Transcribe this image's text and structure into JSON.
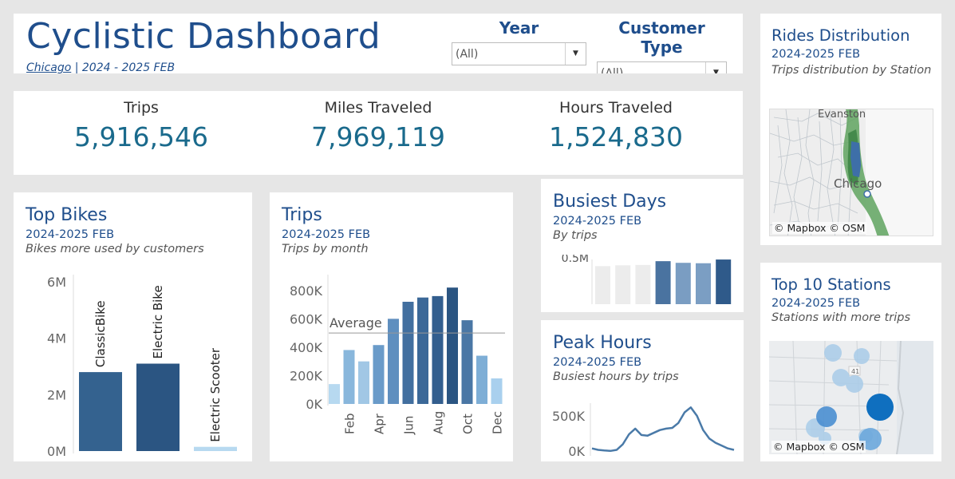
{
  "header": {
    "title": "Cyclistic Dashboard",
    "location": "Chicago",
    "period": " | 2024 - 2025 FEB",
    "filters": [
      {
        "label": "Year",
        "value": "(All)"
      },
      {
        "label": "Customer Type",
        "value": "(All)"
      }
    ]
  },
  "kpis": [
    {
      "label": "Trips",
      "value": "5,916,546"
    },
    {
      "label": "Miles Traveled",
      "value": "7,969,119"
    },
    {
      "label": "Hours Traveled",
      "value": "1,524,830"
    }
  ],
  "rides": {
    "title": "Rides Distribution",
    "subtitle": "2024-2025 FEB",
    "description": "Trips distribution by Station",
    "map_label_1": "Evanston",
    "map_label_2": "Chicago",
    "credit": "© Mapbox © OSM"
  },
  "stations": {
    "title": "Top 10 Stations",
    "subtitle": "2024-2025 FEB",
    "description": "Stations with more trips",
    "road_label": "41",
    "credit": "© Mapbox © OSM"
  },
  "top_bikes": {
    "title": "Top Bikes",
    "subtitle": "2024-2025 FEB",
    "description": "Bikes more used by customers"
  },
  "trips_chart": {
    "title": "Trips",
    "subtitle": "2024-2025 FEB",
    "description": "Trips by month"
  },
  "busiest": {
    "title": "Busiest Days",
    "subtitle": "2024-2025 FEB",
    "description": "By trips"
  },
  "peak": {
    "title": "Peak Hours",
    "subtitle": "2024-2025 FEB",
    "description": "Busiest hours by trips"
  },
  "chart_data": [
    {
      "id": "top_bikes",
      "type": "bar",
      "categories": [
        "ClassicBike",
        "Electric Bike",
        "Electric Scooter"
      ],
      "values": [
        2800000,
        3100000,
        150000
      ],
      "colors": [
        "#34628f",
        "#2b5582",
        "#b7d9f0"
      ],
      "ylim": [
        0,
        6200000
      ],
      "yticks": [
        0,
        2000000,
        4000000,
        6000000
      ],
      "ytick_labels": [
        "0M",
        "2M",
        "4M",
        "6M"
      ]
    },
    {
      "id": "trips_by_month",
      "type": "bar",
      "categories": [
        "Jan",
        "Feb",
        "Mar",
        "Apr",
        "May",
        "Jun",
        "Jul",
        "Aug",
        "Sep",
        "Oct",
        "Nov",
        "Dec"
      ],
      "x_tick_labels": [
        "",
        "Feb",
        "",
        "Apr",
        "",
        "Jun",
        "",
        "Aug",
        "",
        "Oct",
        "",
        "Dec"
      ],
      "values": [
        140000,
        380000,
        300000,
        415000,
        600000,
        720000,
        750000,
        760000,
        820000,
        590000,
        340000,
        180000
      ],
      "colors": [
        "#b7d9f0",
        "#89b7dc",
        "#a1c7e5",
        "#6a9bc9",
        "#5f8fbf",
        "#426f9f",
        "#3b6898",
        "#335e8e",
        "#2b5582",
        "#4a77a5",
        "#7eaed6",
        "#a9d0ee"
      ],
      "average": 500000,
      "average_label": "Average",
      "ylim": [
        0,
        900000
      ],
      "yticks": [
        0,
        200000,
        400000,
        600000,
        800000
      ],
      "ytick_labels": [
        "0K",
        "200K",
        "400K",
        "600K",
        "800K"
      ]
    },
    {
      "id": "busiest_days",
      "type": "bar",
      "categories": [
        "1",
        "2",
        "3",
        "4",
        "5",
        "6",
        "7"
      ],
      "values": [
        460000,
        470000,
        475000,
        520000,
        500000,
        495000,
        540000
      ],
      "colors": [
        "#ececec",
        "#ececec",
        "#ececec",
        "#4a73a0",
        "#7a9dc2",
        "#7b9ec3",
        "#2f5a8a"
      ],
      "ylim": [
        0,
        560000
      ],
      "yticks": [
        500000
      ],
      "ytick_labels": [
        "0.5M"
      ]
    },
    {
      "id": "peak_hours",
      "type": "line",
      "x": [
        0,
        1,
        2,
        3,
        4,
        5,
        6,
        7,
        8,
        9,
        10,
        11,
        12,
        13,
        14,
        15,
        16,
        17,
        18,
        19,
        20,
        21,
        22,
        23
      ],
      "values": [
        40000,
        20000,
        10000,
        5000,
        20000,
        100000,
        240000,
        320000,
        230000,
        220000,
        260000,
        300000,
        320000,
        330000,
        400000,
        550000,
        620000,
        500000,
        300000,
        180000,
        120000,
        80000,
        40000,
        20000
      ],
      "color": "#4a7aa8",
      "ylim": [
        -20000,
        680000
      ],
      "yticks": [
        0,
        500000
      ],
      "ytick_labels": [
        "0K",
        "500K"
      ]
    }
  ]
}
